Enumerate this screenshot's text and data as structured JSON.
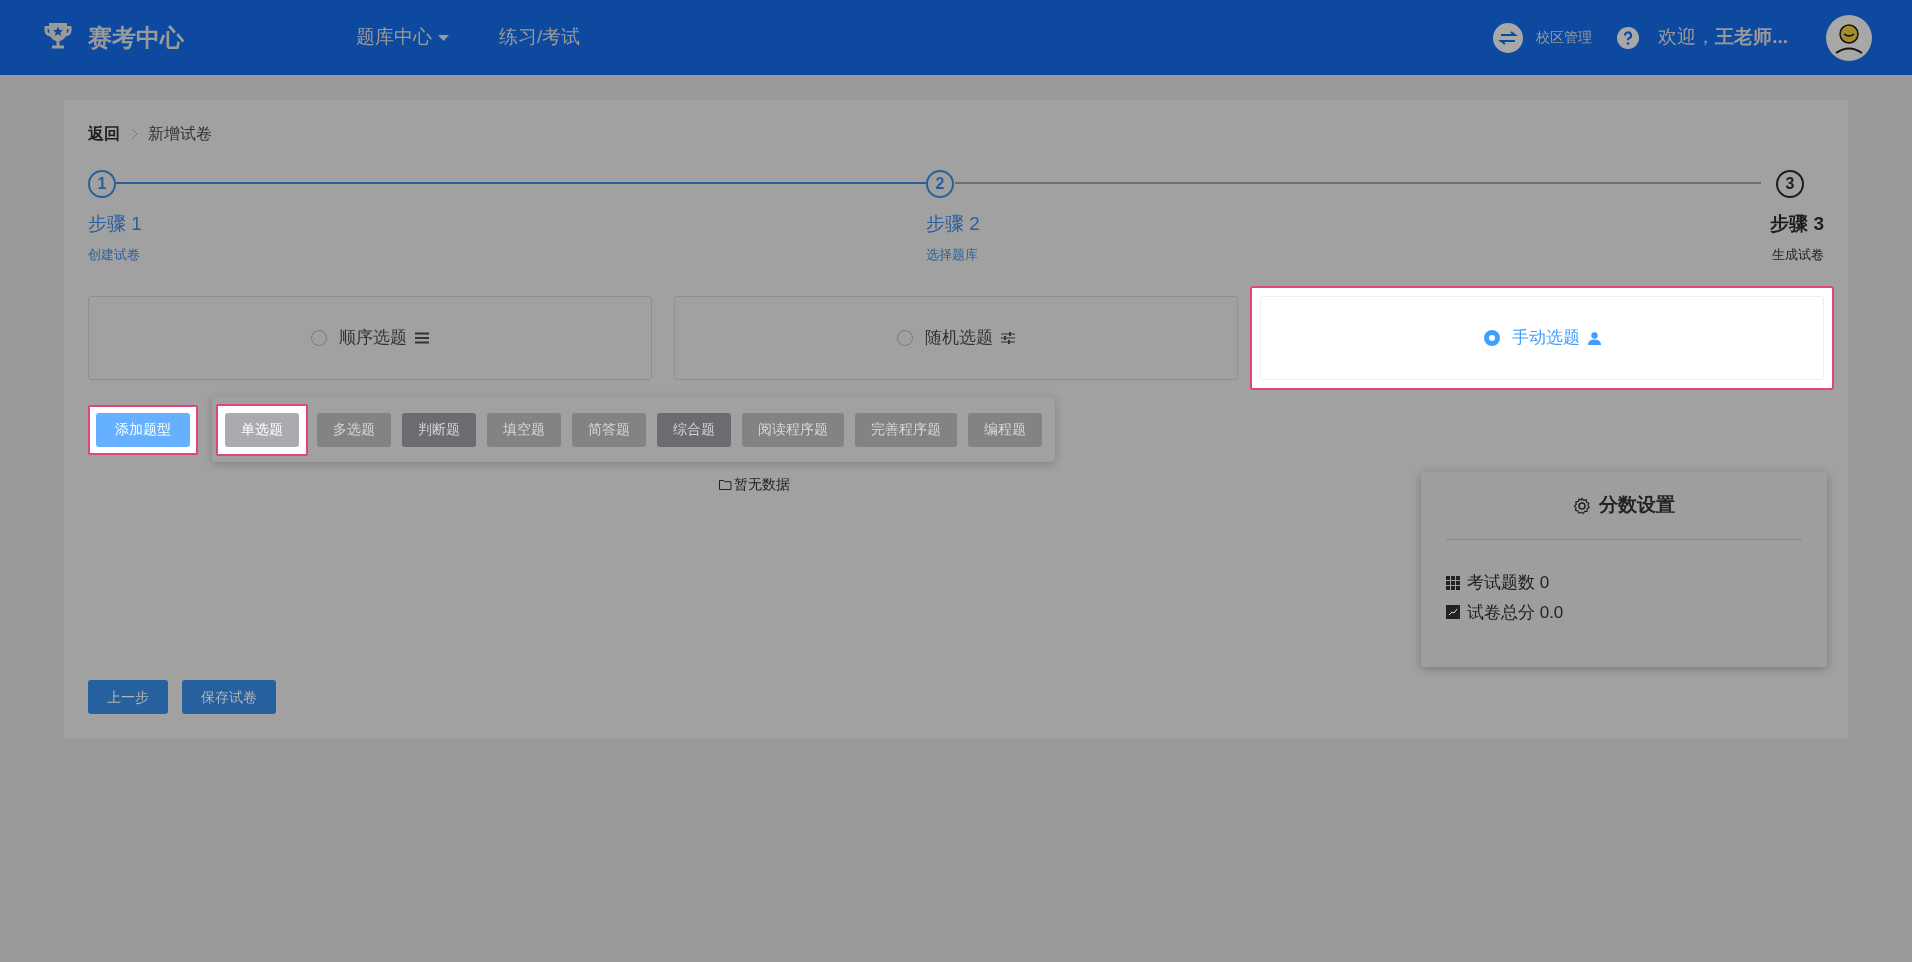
{
  "header": {
    "title": "赛考中心",
    "nav": [
      {
        "label": "题库中心",
        "dropdown": true
      },
      {
        "label": "练习/考试",
        "dropdown": false
      }
    ],
    "campus": "校区管理",
    "welcome": "欢迎，**王老师...**"
  },
  "breadcrumb": {
    "back": "返回",
    "current": "新增试卷"
  },
  "steps": [
    {
      "number": "1",
      "title": "步骤 1",
      "subtitle": "创建试卷",
      "done": true
    },
    {
      "number": "2",
      "title": "步骤 2",
      "subtitle": "选择题库",
      "done": true
    },
    {
      "number": "3",
      "title": "步骤 3",
      "subtitle": "生成试卷",
      "done": false
    }
  ],
  "modes": [
    {
      "label": "顺序选题",
      "selected": false,
      "highlighted": false
    },
    {
      "label": "随机选题",
      "selected": false,
      "highlighted": false
    },
    {
      "label": "手动选题",
      "selected": true,
      "highlighted": true
    }
  ],
  "add_button": {
    "label": "添加题型",
    "highlighted": true
  },
  "question_types": [
    {
      "label": "单选题",
      "filled": false,
      "highlighted": true
    },
    {
      "label": "多选题",
      "filled": false,
      "highlighted": false
    },
    {
      "label": "判断题",
      "filled": true,
      "highlighted": false
    },
    {
      "label": "填空题",
      "filled": false,
      "highlighted": false
    },
    {
      "label": "简答题",
      "filled": false,
      "highlighted": false
    },
    {
      "label": "综合题",
      "filled": true,
      "highlighted": false
    },
    {
      "label": "阅读程序题",
      "filled": false,
      "highlighted": false
    },
    {
      "label": "完善程序题",
      "filled": false,
      "highlighted": false
    },
    {
      "label": "编程题",
      "filled": false,
      "highlighted": false
    }
  ],
  "empty_text": "暂无数据",
  "score_panel": {
    "title": "分数设置",
    "stats": [
      "考试题数 0",
      "试卷总分 0.0"
    ]
  },
  "buttons": [
    "上一步",
    "保存试卷"
  ]
}
